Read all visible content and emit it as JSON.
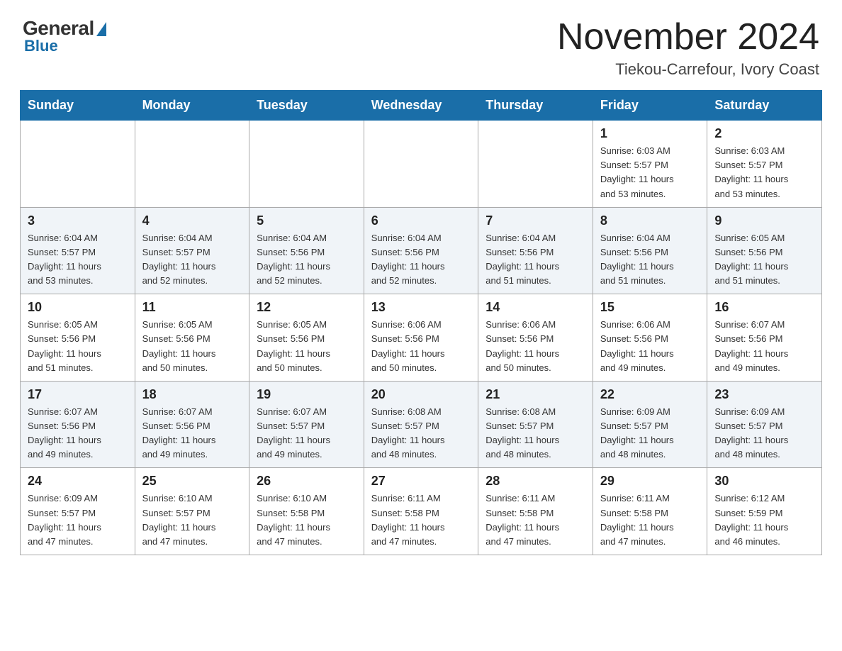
{
  "header": {
    "logo_general": "General",
    "logo_blue": "Blue",
    "month_title": "November 2024",
    "location": "Tiekou-Carrefour, Ivory Coast"
  },
  "days_of_week": [
    "Sunday",
    "Monday",
    "Tuesday",
    "Wednesday",
    "Thursday",
    "Friday",
    "Saturday"
  ],
  "weeks": [
    [
      {
        "num": "",
        "info": ""
      },
      {
        "num": "",
        "info": ""
      },
      {
        "num": "",
        "info": ""
      },
      {
        "num": "",
        "info": ""
      },
      {
        "num": "",
        "info": ""
      },
      {
        "num": "1",
        "info": "Sunrise: 6:03 AM\nSunset: 5:57 PM\nDaylight: 11 hours\nand 53 minutes."
      },
      {
        "num": "2",
        "info": "Sunrise: 6:03 AM\nSunset: 5:57 PM\nDaylight: 11 hours\nand 53 minutes."
      }
    ],
    [
      {
        "num": "3",
        "info": "Sunrise: 6:04 AM\nSunset: 5:57 PM\nDaylight: 11 hours\nand 53 minutes."
      },
      {
        "num": "4",
        "info": "Sunrise: 6:04 AM\nSunset: 5:57 PM\nDaylight: 11 hours\nand 52 minutes."
      },
      {
        "num": "5",
        "info": "Sunrise: 6:04 AM\nSunset: 5:56 PM\nDaylight: 11 hours\nand 52 minutes."
      },
      {
        "num": "6",
        "info": "Sunrise: 6:04 AM\nSunset: 5:56 PM\nDaylight: 11 hours\nand 52 minutes."
      },
      {
        "num": "7",
        "info": "Sunrise: 6:04 AM\nSunset: 5:56 PM\nDaylight: 11 hours\nand 51 minutes."
      },
      {
        "num": "8",
        "info": "Sunrise: 6:04 AM\nSunset: 5:56 PM\nDaylight: 11 hours\nand 51 minutes."
      },
      {
        "num": "9",
        "info": "Sunrise: 6:05 AM\nSunset: 5:56 PM\nDaylight: 11 hours\nand 51 minutes."
      }
    ],
    [
      {
        "num": "10",
        "info": "Sunrise: 6:05 AM\nSunset: 5:56 PM\nDaylight: 11 hours\nand 51 minutes."
      },
      {
        "num": "11",
        "info": "Sunrise: 6:05 AM\nSunset: 5:56 PM\nDaylight: 11 hours\nand 50 minutes."
      },
      {
        "num": "12",
        "info": "Sunrise: 6:05 AM\nSunset: 5:56 PM\nDaylight: 11 hours\nand 50 minutes."
      },
      {
        "num": "13",
        "info": "Sunrise: 6:06 AM\nSunset: 5:56 PM\nDaylight: 11 hours\nand 50 minutes."
      },
      {
        "num": "14",
        "info": "Sunrise: 6:06 AM\nSunset: 5:56 PM\nDaylight: 11 hours\nand 50 minutes."
      },
      {
        "num": "15",
        "info": "Sunrise: 6:06 AM\nSunset: 5:56 PM\nDaylight: 11 hours\nand 49 minutes."
      },
      {
        "num": "16",
        "info": "Sunrise: 6:07 AM\nSunset: 5:56 PM\nDaylight: 11 hours\nand 49 minutes."
      }
    ],
    [
      {
        "num": "17",
        "info": "Sunrise: 6:07 AM\nSunset: 5:56 PM\nDaylight: 11 hours\nand 49 minutes."
      },
      {
        "num": "18",
        "info": "Sunrise: 6:07 AM\nSunset: 5:56 PM\nDaylight: 11 hours\nand 49 minutes."
      },
      {
        "num": "19",
        "info": "Sunrise: 6:07 AM\nSunset: 5:57 PM\nDaylight: 11 hours\nand 49 minutes."
      },
      {
        "num": "20",
        "info": "Sunrise: 6:08 AM\nSunset: 5:57 PM\nDaylight: 11 hours\nand 48 minutes."
      },
      {
        "num": "21",
        "info": "Sunrise: 6:08 AM\nSunset: 5:57 PM\nDaylight: 11 hours\nand 48 minutes."
      },
      {
        "num": "22",
        "info": "Sunrise: 6:09 AM\nSunset: 5:57 PM\nDaylight: 11 hours\nand 48 minutes."
      },
      {
        "num": "23",
        "info": "Sunrise: 6:09 AM\nSunset: 5:57 PM\nDaylight: 11 hours\nand 48 minutes."
      }
    ],
    [
      {
        "num": "24",
        "info": "Sunrise: 6:09 AM\nSunset: 5:57 PM\nDaylight: 11 hours\nand 47 minutes."
      },
      {
        "num": "25",
        "info": "Sunrise: 6:10 AM\nSunset: 5:57 PM\nDaylight: 11 hours\nand 47 minutes."
      },
      {
        "num": "26",
        "info": "Sunrise: 6:10 AM\nSunset: 5:58 PM\nDaylight: 11 hours\nand 47 minutes."
      },
      {
        "num": "27",
        "info": "Sunrise: 6:11 AM\nSunset: 5:58 PM\nDaylight: 11 hours\nand 47 minutes."
      },
      {
        "num": "28",
        "info": "Sunrise: 6:11 AM\nSunset: 5:58 PM\nDaylight: 11 hours\nand 47 minutes."
      },
      {
        "num": "29",
        "info": "Sunrise: 6:11 AM\nSunset: 5:58 PM\nDaylight: 11 hours\nand 47 minutes."
      },
      {
        "num": "30",
        "info": "Sunrise: 6:12 AM\nSunset: 5:59 PM\nDaylight: 11 hours\nand 46 minutes."
      }
    ]
  ]
}
